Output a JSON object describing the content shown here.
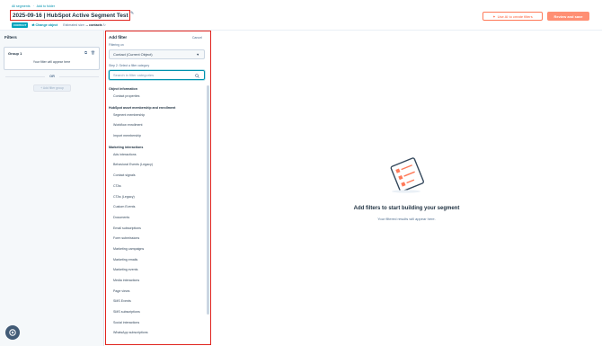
{
  "header": {
    "breadcrumbs": [
      "All segments",
      "Add to folder"
    ],
    "title": "2025-09-16 | HubSpot Active Segment Test",
    "object_badge": "CONTACT",
    "change_object_label": "Change object",
    "estimated_label": "Estimated size:",
    "estimated_value": "-- contacts",
    "use_ai_label": "Use AI to create filters",
    "save_label": "Review and save"
  },
  "filters_panel": {
    "heading": "Filters",
    "group_title": "Group 1",
    "group_empty_text": "Your filter will appear here",
    "or_label": "OR",
    "add_group_label": "+ Add filter group"
  },
  "add_filter": {
    "title": "Add filter",
    "cancel_label": "Cancel",
    "filtering_on_label": "Filtering on",
    "object_value": "Contact (Current Object)",
    "step_label": "Step 2: Select a filter category",
    "search_placeholder": "Search in filter categories",
    "categories": [
      {
        "heading": "Object information",
        "items": [
          "Contact properties"
        ]
      },
      {
        "heading": "HubSpot asset membership and enrollment",
        "items": [
          "Segment membership",
          "Workflow enrollment",
          "Import membership"
        ]
      },
      {
        "heading": "Marketing interactions",
        "items": [
          "Ads interactions",
          "Behavioral Events (Legacy)",
          "Contact signals",
          "CTAs",
          "CTAs (Legacy)",
          "Custom Events",
          "Documents",
          "Email subscriptions",
          "Form submissions",
          "Marketing campaigns",
          "Marketing emails",
          "Marketing events",
          "Media interactions",
          "Page views",
          "SMS Events",
          "SMS subscriptions",
          "Social interactions",
          "WhatsApp subscriptions"
        ]
      }
    ]
  },
  "empty_state": {
    "title": "Add filters to start building your segment",
    "subtitle": "Your filtered results will appear here."
  },
  "colors": {
    "accent": "#ff7a59",
    "link": "#0091ae",
    "highlight": "#e0241e"
  }
}
